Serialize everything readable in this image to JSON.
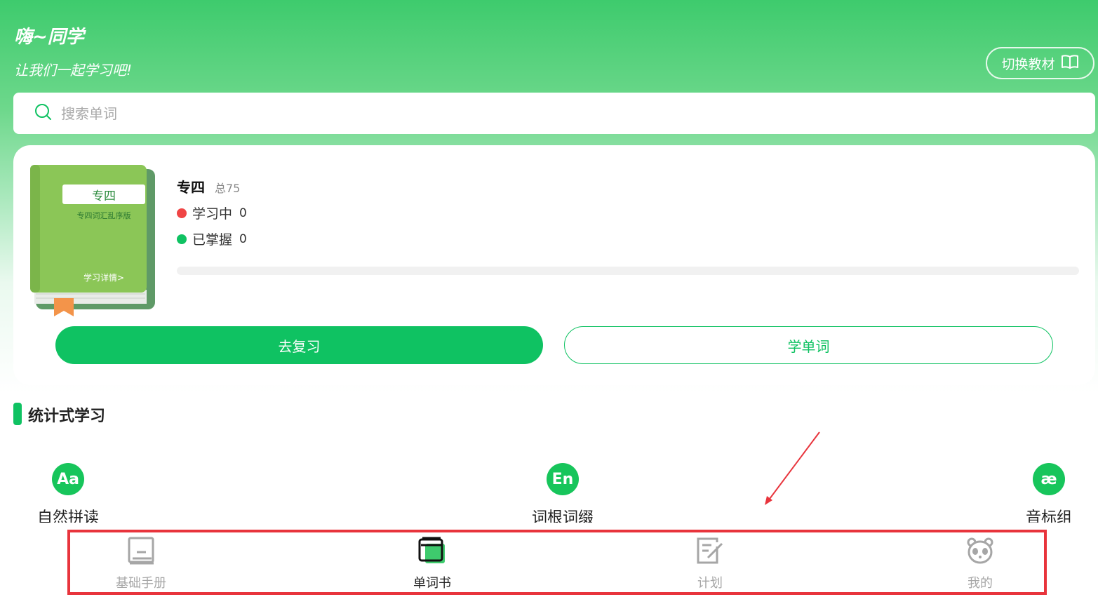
{
  "header": {
    "greeting": "嗨~同学",
    "subgreeting": "让我们一起学习吧!",
    "switch_textbook_label": "切换教材"
  },
  "search": {
    "placeholder": "搜索单词",
    "value": ""
  },
  "current_book": {
    "cover_title": "专四",
    "cover_subtitle": "专四词汇乱序版",
    "cover_detail_link": "学习详情>",
    "name": "专四",
    "total_label": "总75",
    "learning_label": "学习中",
    "learning_count": "0",
    "mastered_label": "已掌握",
    "mastered_count": "0",
    "progress": 0,
    "review_button": "去复习",
    "learn_button": "学单词"
  },
  "section": {
    "title": "统计式学习"
  },
  "features": [
    {
      "label": "自然拼读",
      "icon": "Aa",
      "icon_name": "phonics-icon"
    },
    {
      "label": "词根词缀",
      "icon": "En",
      "icon_name": "word-root-icon"
    },
    {
      "label": "音标组",
      "icon": "æ",
      "icon_name": "phonetic-icon"
    }
  ],
  "tab_bar": {
    "tabs": [
      {
        "label": "基础手册",
        "icon": "handbook-icon",
        "active": false
      },
      {
        "label": "单词书",
        "icon": "wordbook-icon",
        "active": true
      },
      {
        "label": "计划",
        "icon": "plan-icon",
        "active": false
      },
      {
        "label": "我的",
        "icon": "profile-icon",
        "active": false
      }
    ]
  },
  "colors": {
    "brand_green": "#0fc262",
    "learning_dot": "#f04545",
    "mastered_dot": "#0fc262",
    "annotation_red": "#e8343c",
    "cover_green": "#8bc657"
  }
}
